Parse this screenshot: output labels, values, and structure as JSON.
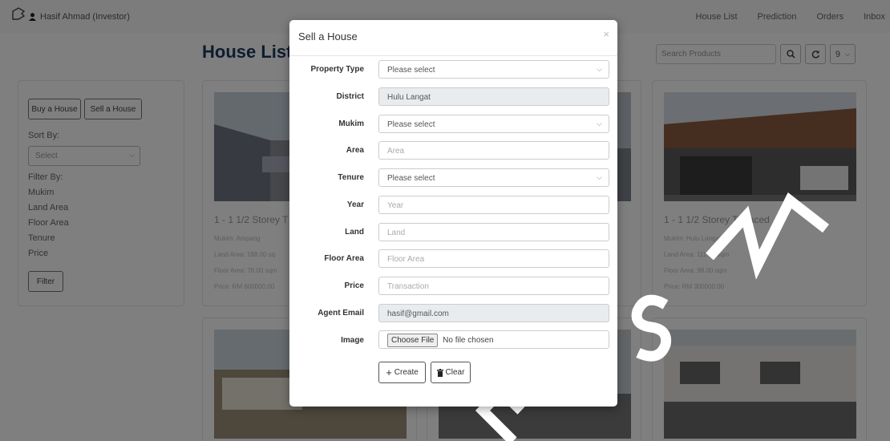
{
  "navbar": {
    "user": "Hasif Ahmad (Investor)",
    "links": [
      "House List",
      "Prediction",
      "Orders",
      "Inbox"
    ]
  },
  "page": {
    "title": "House List"
  },
  "toolbar": {
    "search_placeholder": "Search Products",
    "page_size": "9"
  },
  "sidebar": {
    "buy_label": "Buy a House",
    "sell_label": "Sell a House",
    "sort_label": "Sort By:",
    "sort_value": "Select",
    "filter_label": "Filter By:",
    "filters": [
      "Mukim",
      "Land Area",
      "Floor Area",
      "Tenure",
      "Price"
    ],
    "filter_button": "Filter"
  },
  "cards": [
    {
      "title": "1 - 1 1/2 Storey T",
      "mukim": "Mukim: Ampang",
      "land": "Land Area: 188.00 sq",
      "floor": "Floor Area: 76.00 sqm",
      "price": "Price: RM 600000.00"
    },
    {
      "title": "1 - 1 1/2 Storey Terraced",
      "mukim": "Mukim: Hulu Langat",
      "land": "Land Area: 111.48 sqm",
      "floor": "Floor Area: 98.00 sqm",
      "price": "Price: RM 300000.00"
    }
  ],
  "modal": {
    "title": "Sell a House",
    "close": "×",
    "fields": {
      "property_type": {
        "label": "Property Type",
        "value": "Please select"
      },
      "district": {
        "label": "District",
        "value": "Hulu Langat"
      },
      "mukim": {
        "label": "Mukim",
        "value": "Please select"
      },
      "area": {
        "label": "Area",
        "placeholder": "Area"
      },
      "tenure": {
        "label": "Tenure",
        "value": "Please select"
      },
      "year": {
        "label": "Year",
        "placeholder": "Year"
      },
      "land": {
        "label": "Land",
        "placeholder": "Land"
      },
      "floor_area": {
        "label": "Floor Area",
        "placeholder": "Floor Area"
      },
      "price": {
        "label": "Price",
        "placeholder": "Transaction"
      },
      "agent_email": {
        "label": "Agent Email",
        "value": "hasif@gmail.com"
      },
      "image": {
        "label": "Image",
        "button": "Choose File",
        "status": "No file chosen"
      }
    },
    "create_label": "Create",
    "clear_label": "Clear"
  },
  "watermark": "ETSM",
  "colors": {
    "title": "#1a3a5c",
    "backdrop": "rgba(0,0,0,0.5)"
  }
}
